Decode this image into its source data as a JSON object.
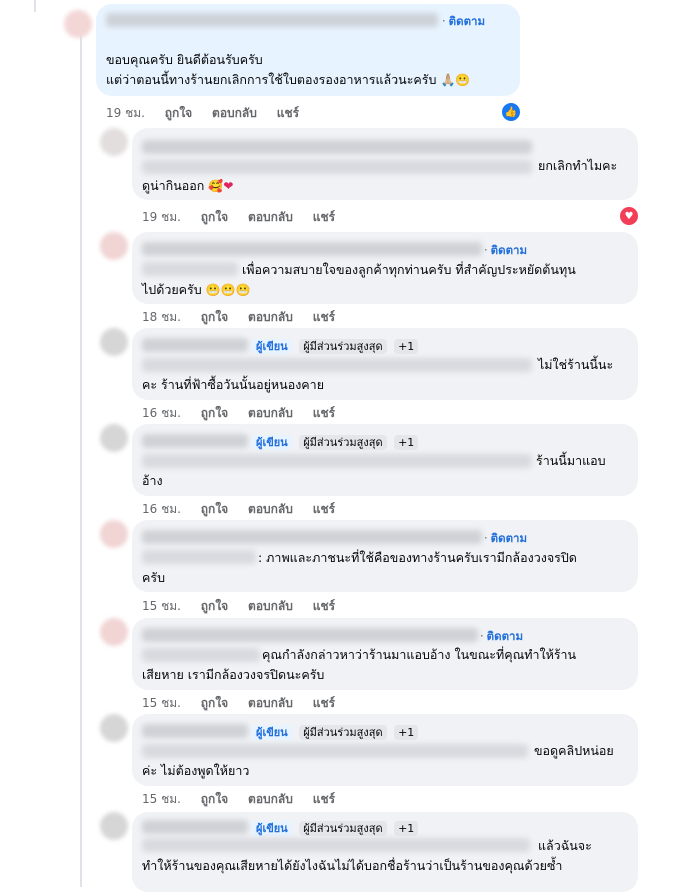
{
  "actions": {
    "like": "ถูกใจ",
    "reply": "ตอบกลับ",
    "share": "แชร์"
  },
  "follow_label": "ติดตาม",
  "badges": {
    "author": "ผู้เขียน",
    "top_fan": "ผู้มีส่วนร่วมสูงสุด",
    "plus": "+1"
  },
  "comments": [
    {
      "id": "c0",
      "lines": [
        "ขอบคุณครับ ยินดีต้อนรับครับ",
        "แต่ว่าตอนนี้ทางร้านยกเลิกการใช้ใบตองรองอาหารแล้วนะครับ"
      ],
      "time": "19 ชม.",
      "reaction": "like-icon",
      "avatar_color": "#f3d6d6"
    },
    {
      "id": "c1",
      "lines": [
        "ยกเลิกทำไมคะ",
        "ดูน่ากินออก"
      ],
      "time": "19 ชม.",
      "reaction": "love-icon",
      "avatar_color": "#e2dede"
    },
    {
      "id": "c2",
      "lines": [
        "เพื่อความสบายใจของลูกค้าทุกท่านครับ ที่สำคัญประหยัดต้นทุน",
        "ไปด้วยครับ"
      ],
      "time": "18 ชม.",
      "avatar_color": "#f1d4d4"
    },
    {
      "id": "c3",
      "lines": [
        "ไม่ใช่ร้านนี้นะ",
        "คะ ร้านที่ฟ้าซื้อวันนั้นอยู่หนองคาย"
      ],
      "time": "16 ชม.",
      "avatar_color": "#d6d6d6"
    },
    {
      "id": "c4",
      "lines": [
        "ร้านนี้มาแอบ",
        "อ้าง"
      ],
      "time": "16 ชม.",
      "avatar_color": "#d6d6d6"
    },
    {
      "id": "c5",
      "lines": [
        ": ภาพและภาชนะที่ใช้คือของทางร้านครับเรามีกล้องวงจรปิด",
        "ครับ"
      ],
      "time": "15 ชม.",
      "avatar_color": "#f1d4d4"
    },
    {
      "id": "c6",
      "lines": [
        "คุณกำลังกล่าวหาว่าร้านมาแอบอ้าง ในขณะที่คุณทำให้ร้าน",
        "เสียหาย เรามีกล้องวงจรปิดนะครับ"
      ],
      "time": "15 ชม.",
      "avatar_color": "#f1d4d4"
    },
    {
      "id": "c7",
      "lines": [
        "ขอดูคลิปหน่อย",
        "ค่ะ ไม่ต้องพูดให้ยาว"
      ],
      "time": "15 ชม.",
      "avatar_color": "#d6d6d6"
    },
    {
      "id": "c8",
      "lines": [
        "แล้วฉันจะ",
        "ทำให้ร้านของคุณเสียหายได้ยังไงฉันไม่ได้บอกชื่อร้านว่าเป็นร้านของคุณด้วยซ้ำ"
      ],
      "avatar_color": "#d6d6d6"
    }
  ]
}
